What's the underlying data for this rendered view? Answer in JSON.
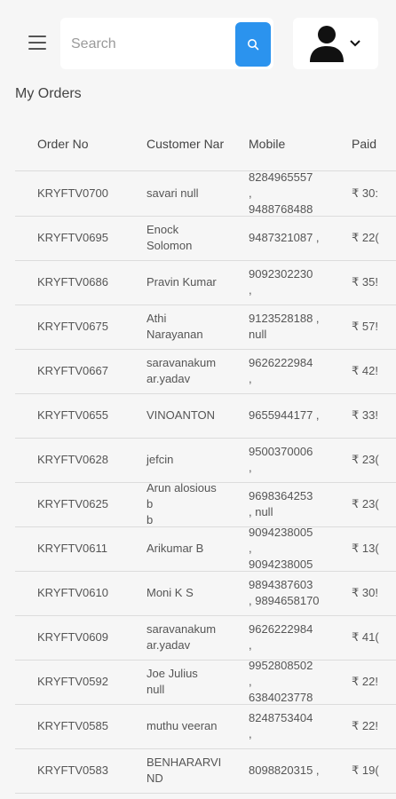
{
  "header": {
    "search_placeholder": "Search",
    "icons": {
      "menu": "menu-icon",
      "search": "search-icon",
      "avatar": "user-avatar-icon",
      "dropdown": "chevron-down-icon"
    },
    "accent_color": "#2b93ee"
  },
  "page": {
    "title": "My Orders"
  },
  "table": {
    "columns": [
      "Order No",
      "Customer Nar",
      "Mobile",
      "Paid"
    ],
    "rows": [
      {
        "order_no": "KRYFTV0700",
        "customer": [
          "savari null"
        ],
        "mobile": [
          "8284965557",
          ",",
          "9488768488"
        ],
        "paid": "₹ 30:"
      },
      {
        "order_no": "KRYFTV0695",
        "customer": [
          "Enock",
          "Solomon"
        ],
        "mobile": [
          "9487321087 ,"
        ],
        "paid": "₹ 22("
      },
      {
        "order_no": "KRYFTV0686",
        "customer": [
          "Pravin Kumar"
        ],
        "mobile": [
          "9092302230",
          ","
        ],
        "paid": "₹ 35!"
      },
      {
        "order_no": "KRYFTV0675",
        "customer": [
          "Athi",
          "Narayanan"
        ],
        "mobile": [
          "9123528188 ,",
          "null"
        ],
        "paid": "₹ 57!"
      },
      {
        "order_no": "KRYFTV0667",
        "customer": [
          "saravanakum",
          "ar.yadav"
        ],
        "mobile": [
          "9626222984",
          ","
        ],
        "paid": "₹ 42!"
      },
      {
        "order_no": "KRYFTV0655",
        "customer": [
          "VINOANTON"
        ],
        "mobile": [
          "9655944177 ,"
        ],
        "paid": "₹ 33!"
      },
      {
        "order_no": "KRYFTV0628",
        "customer": [
          "jefcin"
        ],
        "mobile": [
          "9500370006",
          ","
        ],
        "paid": "₹ 23("
      },
      {
        "order_no": "KRYFTV0625",
        "customer": [
          "Arun alosious",
          "b",
          "b"
        ],
        "mobile": [
          "9698364253",
          ", null"
        ],
        "paid": "₹ 23("
      },
      {
        "order_no": "KRYFTV0611",
        "customer": [
          "Arikumar B"
        ],
        "mobile": [
          "9094238005",
          ",",
          "9094238005"
        ],
        "paid": "₹ 13("
      },
      {
        "order_no": "KRYFTV0610",
        "customer": [
          "Moni K S"
        ],
        "mobile": [
          "9894387603",
          ", 9894658170"
        ],
        "paid": "₹ 30!"
      },
      {
        "order_no": "KRYFTV0609",
        "customer": [
          "saravanakum",
          "ar.yadav"
        ],
        "mobile": [
          "9626222984",
          ","
        ],
        "paid": "₹ 41("
      },
      {
        "order_no": "KRYFTV0592",
        "customer": [
          "Joe Julius",
          "null"
        ],
        "mobile": [
          "9952808502",
          ",",
          "6384023778"
        ],
        "paid": "₹ 22!"
      },
      {
        "order_no": "KRYFTV0585",
        "customer": [
          "muthu veeran"
        ],
        "mobile": [
          "8248753404",
          ","
        ],
        "paid": "₹ 22!"
      },
      {
        "order_no": "KRYFTV0583",
        "customer": [
          "BENHARARVI",
          "ND"
        ],
        "mobile": [
          "8098820315 ,"
        ],
        "paid": "₹ 19("
      }
    ]
  }
}
